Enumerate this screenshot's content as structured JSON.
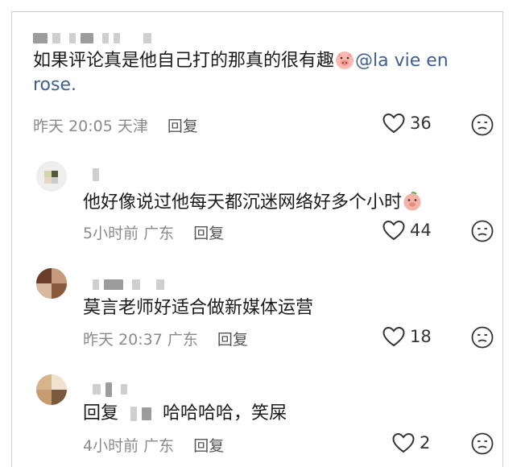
{
  "comments": [
    {
      "text_main": "如果评论真是他自己打的那真的很有趣",
      "mention": "@la vie en rose.",
      "time": "昨天 20:05",
      "location": "天津",
      "reply_label": "回复",
      "likes": "36"
    },
    {
      "text_main": "他好像说过他每天都沉迷网络好多个小时",
      "time": "5小时前",
      "location": "广东",
      "reply_label": "回复",
      "likes": "44"
    },
    {
      "text_main": "莫言老师好适合做新媒体运营",
      "time": "昨天 20:37",
      "location": "广东",
      "reply_label": "回复",
      "likes": "18"
    },
    {
      "reply_prefix": "回复",
      "text_main": "哈哈哈哈，笑屎",
      "time": "4小时前",
      "location": "广东",
      "reply_label": "回复",
      "likes": "2"
    }
  ]
}
